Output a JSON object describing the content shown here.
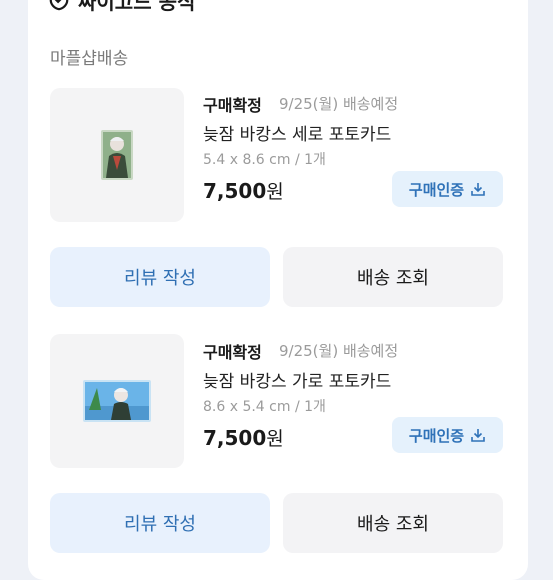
{
  "store": {
    "name": "싸이고드 공식",
    "icon": "store-icon"
  },
  "shipping_group": "마플샵배송",
  "orders": [
    {
      "status": "구매확정",
      "date": "9/25(월) 배송예정",
      "title": "늦잠 바캉스 세로 포토카드",
      "spec": "5.4 x 8.6 cm / 1개",
      "price": "7,500",
      "currency": "원",
      "verify_label": "구매인증",
      "review_label": "리뷰 작성",
      "track_label": "배송 조회"
    },
    {
      "status": "구매확정",
      "date": "9/25(월) 배송예정",
      "title": "늦잠 바캉스 가로 포토카드",
      "spec": "8.6 x 5.4 cm / 1개",
      "price": "7,500",
      "currency": "원",
      "verify_label": "구매인증",
      "review_label": "리뷰 작성",
      "track_label": "배송 조회"
    }
  ],
  "colors": {
    "accent": "#2f72b8",
    "accent_bg": "#e5f1fc",
    "page_bg": "#eef1f7"
  }
}
